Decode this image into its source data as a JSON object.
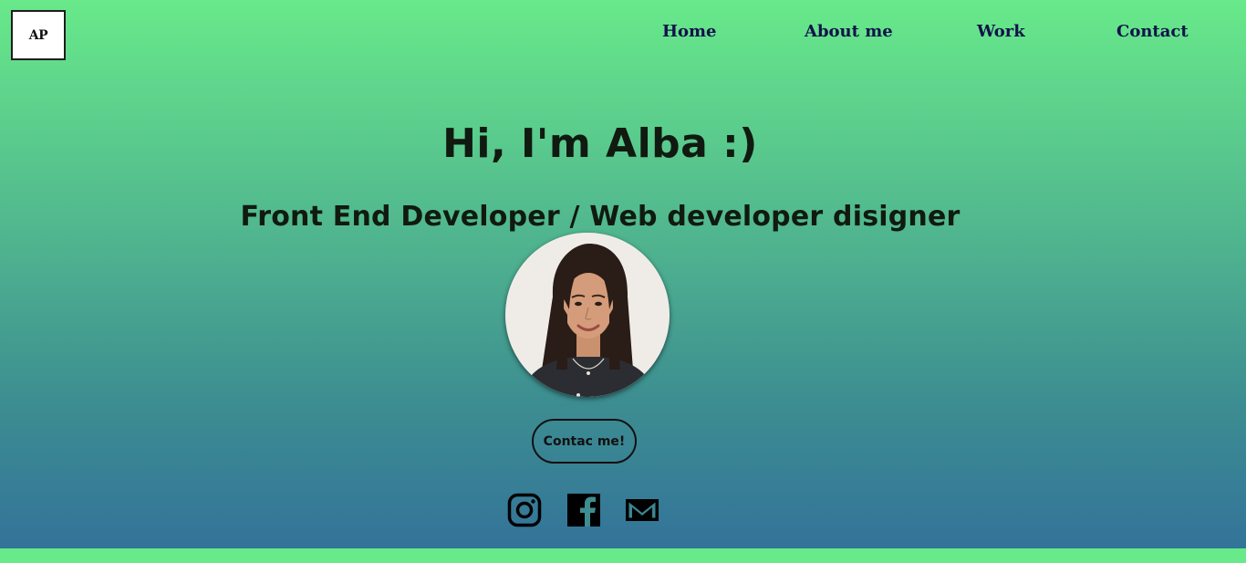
{
  "header": {
    "logo_text": "AP",
    "nav": [
      {
        "label": "Home"
      },
      {
        "label": "About me"
      },
      {
        "label": "Work"
      },
      {
        "label": "Contact"
      }
    ]
  },
  "hero": {
    "title": "Hi, I'm Alba :)",
    "subtitle": "Front End Developer / Web developer disigner",
    "contact_button": "Contac me!"
  },
  "social": [
    {
      "icon": "instagram-icon"
    },
    {
      "icon": "facebook-icon"
    },
    {
      "icon": "mail-icon"
    }
  ],
  "colors": {
    "gradient_top": "#68e98a",
    "gradient_bottom": "#337399",
    "nav_text": "#12124a",
    "heading_text": "#101a10"
  }
}
